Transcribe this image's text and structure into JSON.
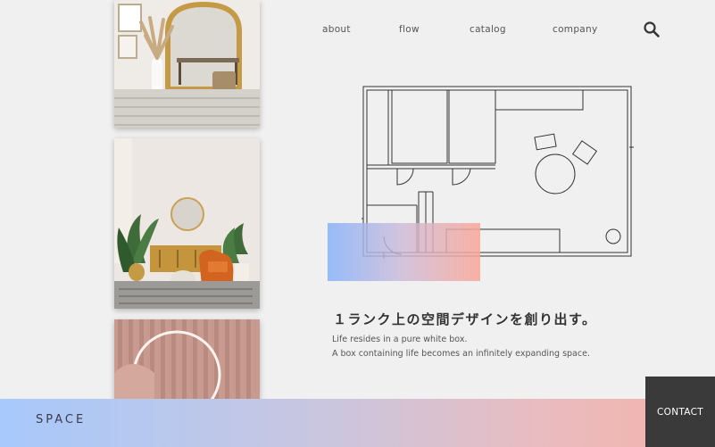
{
  "nav": {
    "items": [
      {
        "label": "about"
      },
      {
        "label": "flow"
      },
      {
        "label": "catalog"
      },
      {
        "label": "company"
      }
    ],
    "search_icon": "search-icon"
  },
  "hero": {
    "headline": "１ランク上の空間デザインを創り出す。",
    "body_lines": [
      "Life resides in a pure white box.",
      "A box containing life becomes an infinitely expanding space."
    ]
  },
  "footer": {
    "brand": "SPACE",
    "contact_label": "CONTACT"
  },
  "colors": {
    "background": "#f0f0f0",
    "gradient_start": "#a7c9fb",
    "gradient_end": "#f6b2a8",
    "contact_bg": "#3a3a3a"
  },
  "images": [
    {
      "name": "photo-mirror-room",
      "description": "room with gold ornate mirror and pampas grass"
    },
    {
      "name": "photo-living-room",
      "description": "living room with orange armchair and plants"
    },
    {
      "name": "photo-pink-wall",
      "description": "pink fluted wall with neon ring light"
    }
  ]
}
